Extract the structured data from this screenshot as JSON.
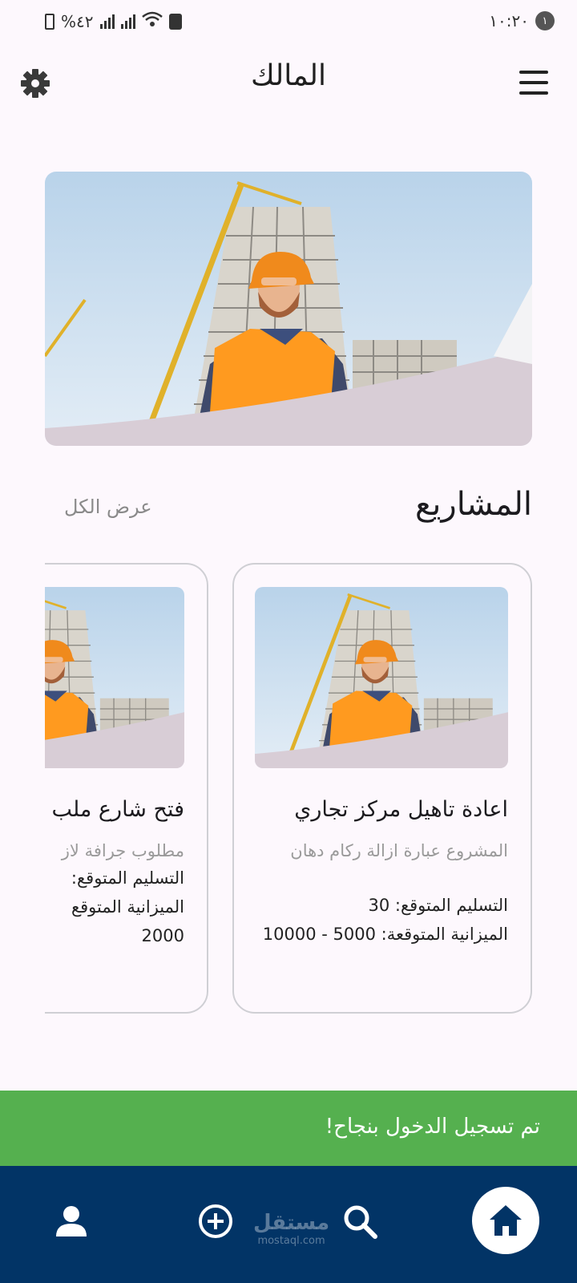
{
  "status_bar": {
    "time": "١٠:٢٠",
    "notification_count": "١",
    "battery": "%٤٢"
  },
  "app_bar": {
    "title": "المالك"
  },
  "projects": {
    "section_title": "المشاريع",
    "see_all": "عرض الكل",
    "items": [
      {
        "title": "اعادة تاهيل مركز تجاري",
        "description": "المشروع عبارة ازالة ركام دهان",
        "delivery": "التسليم المتوقع: 30",
        "budget": "الميزانية المتوقعة: 5000 - 10000"
      },
      {
        "title": "فتح شارع ملب",
        "description": "مطلوب جرافة لاز",
        "delivery": "التسليم المتوقع:",
        "budget": "الميزانية المتوقع",
        "budget_cont": "2000"
      }
    ]
  },
  "snackbar": {
    "message": "تم تسجيل الدخول بنجاح!"
  },
  "bottom_nav": {
    "items": [
      "home-icon",
      "search-icon",
      "add-icon",
      "profile-icon"
    ],
    "watermark_ar": "مستقل",
    "watermark_en": "mostaql.com"
  },
  "colors": {
    "background": "#fdf8fd",
    "nav_bar": "#023466",
    "snackbar": "#55b04f",
    "vest": "#ff9a1f",
    "sky": "#cfe0ef"
  }
}
